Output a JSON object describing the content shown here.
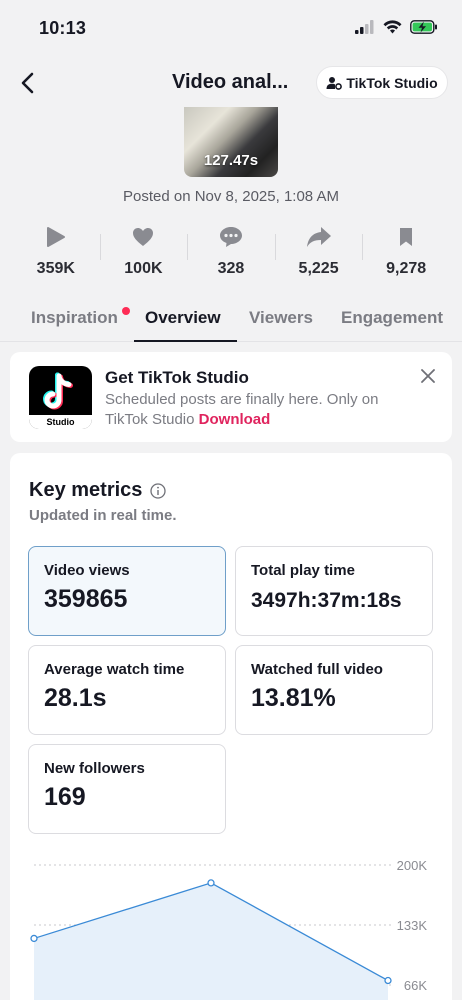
{
  "status_bar": {
    "time": "10:13"
  },
  "header": {
    "title": "Video anal...",
    "studio_button": "TikTok Studio"
  },
  "video": {
    "duration": "127.47s",
    "posted": "Posted on Nov 8, 2025, 1:08 AM"
  },
  "stats": [
    {
      "icon": "play-icon",
      "value": "359K"
    },
    {
      "icon": "heart-icon",
      "value": "100K"
    },
    {
      "icon": "comment-icon",
      "value": "328"
    },
    {
      "icon": "share-icon",
      "value": "5,225"
    },
    {
      "icon": "bookmark-icon",
      "value": "9,278"
    }
  ],
  "tabs": [
    "Inspiration",
    "Overview",
    "Viewers",
    "Engagement"
  ],
  "active_tab": "Overview",
  "promo": {
    "title": "Get TikTok Studio",
    "text": "Scheduled posts are finally here. Only on TikTok Studio",
    "link": "Download",
    "logo_label": "Studio"
  },
  "key_metrics": {
    "title": "Key metrics",
    "subtitle": "Updated in real time.",
    "items": [
      {
        "label": "Video views",
        "value": "359865"
      },
      {
        "label": "Total play time",
        "value": "3497h:37m:18s"
      },
      {
        "label": "Average watch time",
        "value": "28.1s"
      },
      {
        "label": "Watched full video",
        "value": "13.81%"
      },
      {
        "label": "New followers",
        "value": "169"
      }
    ]
  },
  "chart_data": {
    "type": "area",
    "ytick_labels": [
      "200K",
      "133K",
      "66K"
    ],
    "y_ticks": [
      200000,
      133000,
      66000
    ],
    "values": [
      118000,
      180000,
      71000
    ]
  },
  "colors": {
    "accent": "#fe2c55",
    "link": "#e0245e",
    "chart_line": "#3a8ad6",
    "chart_fill": "#e6f0fa"
  }
}
